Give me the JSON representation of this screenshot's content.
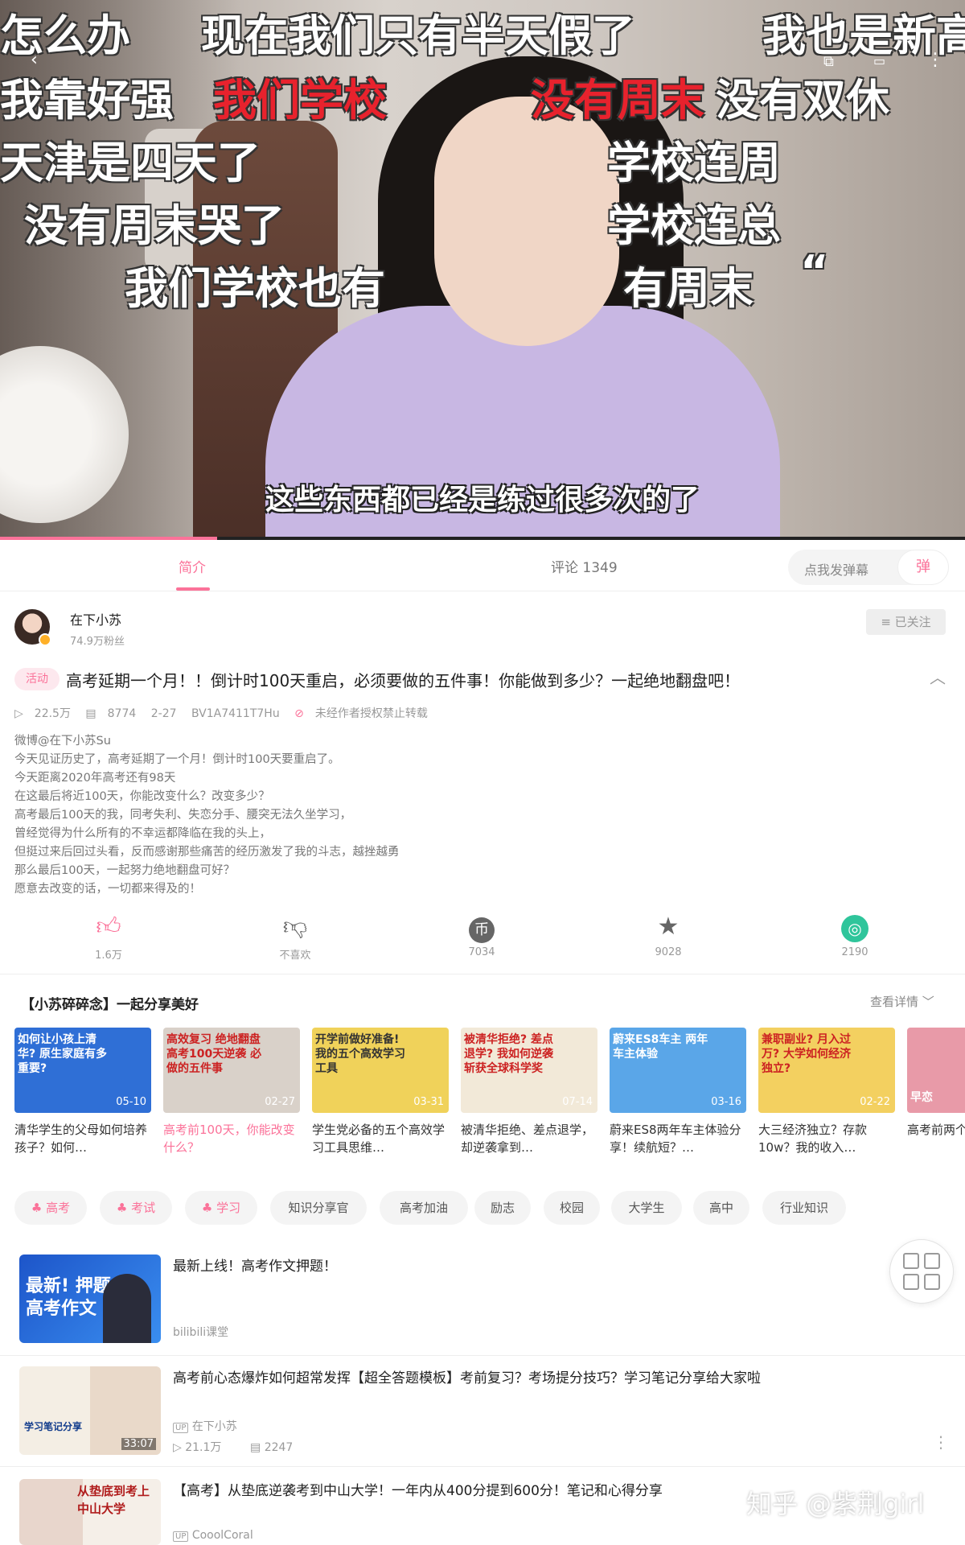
{
  "video": {
    "danmaku": [
      "怎么办",
      "现在我们只有半天假了",
      "我也是新高",
      "我靠好强",
      "我们学校",
      "没有周末",
      "没有双休",
      "天津是四天了",
      "学校连周",
      "没有周末哭了",
      "学校连总",
      "我们学校也有",
      "有周末",
      "“"
    ],
    "subtitle": "这些东西都已经是练过很多次的了"
  },
  "tabs": {
    "intro": "简介",
    "comments": "评论 1349",
    "danmaku_placeholder": "点我发弹幕",
    "danmaku_icon": "弹"
  },
  "author": {
    "name": "在下小苏",
    "fans": "74.9万粉丝",
    "follow_label": "≡ 已关注"
  },
  "video_info": {
    "tag": "活动",
    "title": "高考延期一个月！！倒计时100天重启，必须要做的五件事！你能做到多少？一起绝地翻盘吧！",
    "views": "22.5万",
    "danmaku_count": "8774",
    "date": "2-27",
    "bvid": "BV1A7411T7Hu",
    "copyright": "未经作者授权禁止转载",
    "description": [
      "微博@在下小苏Su",
      "今天见证历史了，高考延期了一个月！倒计时100天要重启了。",
      "今天距离2020年高考还有98天",
      "在这最后将近100天，你能改变什么？改变多少？",
      "高考最后100天的我，同考失利、失恋分手、腰突无法久坐学习，",
      "曾经觉得为什么所有的不幸运都降临在我的头上，",
      "但挺过来后回过头看，反而感谢那些痛苦的经历激发了我的斗志，越挫越勇",
      "那么最后100天，一起努力绝地翻盘可好？",
      "愿意去改变的话，一切都来得及的！"
    ]
  },
  "actions": {
    "like": "1.6万",
    "dislike": "不喜欢",
    "coin": "7034",
    "favorite": "9028",
    "share": "2190"
  },
  "series": {
    "title": "【小苏碎碎念】一起分享美好",
    "more": "查看详情",
    "cards": [
      {
        "cap": "如何让小孩上清华? 原生家庭有多重要?",
        "date": "05-10",
        "title": "清华学生的父母如何培养孩子？如何…",
        "bg": "#2f6fd6"
      },
      {
        "cap": "高效复习 绝地翻盘 高考100天逆袭 必做的五件事",
        "date": "02-27",
        "title": "高考前100天，你能改变什么？",
        "bg": "#d9d1c9"
      },
      {
        "cap": "开学前做好准备! 我的五个高效学习工具",
        "date": "03-31",
        "title": "学生党必备的五个高效学习工具思维…",
        "bg": "#f0d25a"
      },
      {
        "cap": "被清华拒绝? 差点退学? 我如何逆袭 斩获全球科学奖",
        "date": "07-14",
        "title": "被清华拒绝、差点退学，却逆袭拿到…",
        "bg": "#f2e9d8"
      },
      {
        "cap": "蔚来ES8车主 两年车主体验",
        "date": "03-16",
        "title": "蔚来ES8两年车主体验分享！续航短？…",
        "bg": "#5aa6e8"
      },
      {
        "cap": "兼职副业? 月入过万? 大学如何经济独立?",
        "date": "02-22",
        "title": "大三经济独立？存款10w？我的收入…",
        "bg": "#f3d060"
      },
      {
        "cap": "早恋",
        "date": "",
        "title": "高考前两个月失恋了…",
        "bg": "#e89aa8"
      }
    ]
  },
  "tags": [
    "高考",
    "考试",
    "学习",
    "知识分享官",
    "高考加油",
    "励志",
    "校园",
    "大学生",
    "高中",
    "行业知识"
  ],
  "related": [
    {
      "title": "最新上线！高考作文押题！",
      "meta1": "bilibili课堂",
      "meta2": "",
      "duration": "",
      "thumb_text": "最新! 押题 高考作文"
    },
    {
      "title": "高考前心态爆炸如何超常发挥【超全答题模板】考前复习？考场提分技巧？学习笔记分享给大家啦",
      "meta1": "在下小苏",
      "meta2": "21.1万",
      "meta3": "2247",
      "duration": "33:07",
      "thumb_text": "学习笔记分享"
    },
    {
      "title": "【高考】从垫底逆袭考到中山大学！一年内从400分提到600分！笔记和心得分享",
      "meta1": "CooolCoral",
      "meta2": "",
      "duration": "",
      "thumb_text": "从垫底到考上 中山大学"
    }
  ],
  "watermark": "知乎 @紫荆girl"
}
